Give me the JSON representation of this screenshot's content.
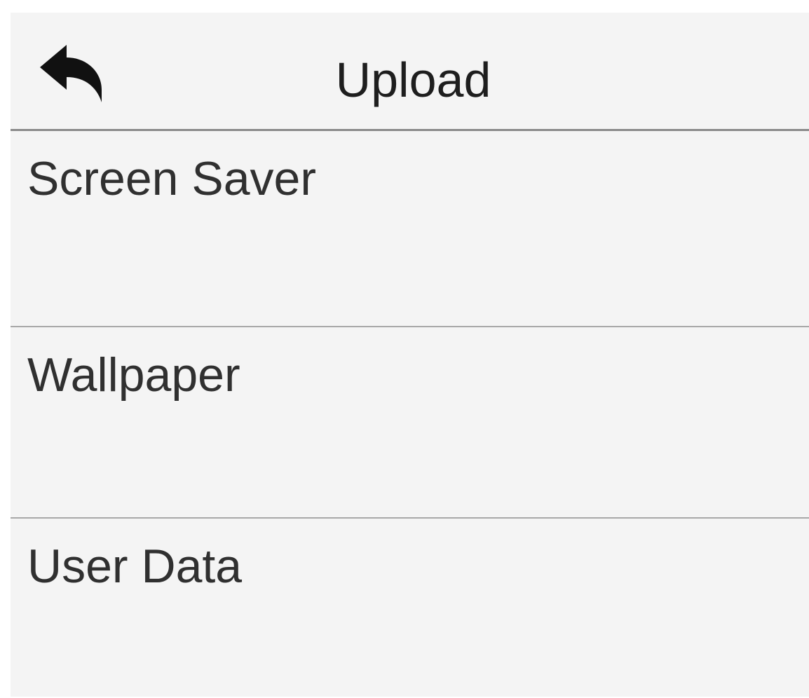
{
  "header": {
    "title": "Upload",
    "back_icon": "back-arrow-icon"
  },
  "menu": {
    "items": [
      {
        "label": "Screen Saver"
      },
      {
        "label": "Wallpaper"
      },
      {
        "label": "User Data"
      }
    ]
  },
  "colors": {
    "background": "#f4f4f4",
    "header_divider": "#8a8a8a",
    "row_divider": "#a8a8a8",
    "text": "#303030"
  }
}
